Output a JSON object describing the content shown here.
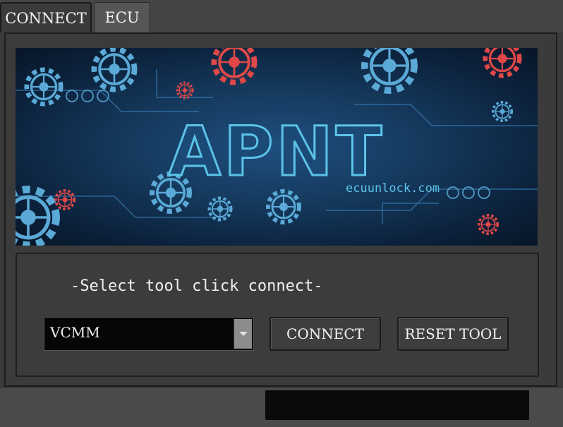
{
  "tabs": [
    {
      "label": "CONNECT",
      "active": true
    },
    {
      "label": "ECU",
      "active": false
    }
  ],
  "banner": {
    "logo_text": "APNT",
    "site_text": "ecuunlock.com",
    "colors": {
      "background": "#153a5e",
      "gear_blue": "#5aa9d6",
      "gear_red": "#e04848",
      "text": "#3fa0c8"
    }
  },
  "connect_panel": {
    "instruction": "-Select tool click connect-",
    "tool_select": {
      "value": "VCMM"
    },
    "connect_label": "CONNECT",
    "reset_label": "RESET TOOL"
  },
  "status": {
    "value": ""
  }
}
